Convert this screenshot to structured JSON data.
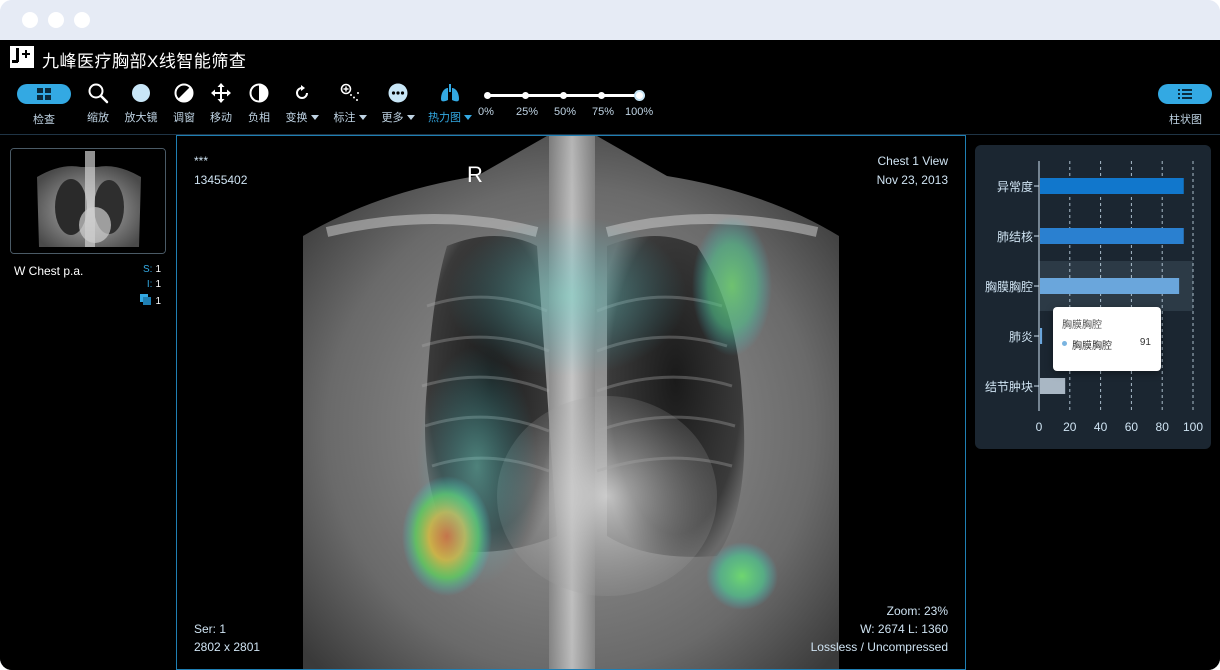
{
  "app": {
    "title": "九峰医疗胸部X线智能筛查"
  },
  "toolbar": {
    "items": [
      {
        "label": "检查",
        "icon": "grid-icon"
      },
      {
        "label": "缩放",
        "icon": "magnifier-icon"
      },
      {
        "label": "放大镜",
        "icon": "circle-icon"
      },
      {
        "label": "调窗",
        "icon": "window-level-icon"
      },
      {
        "label": "移动",
        "icon": "move-arrows-icon"
      },
      {
        "label": "负相",
        "icon": "half-circle-icon"
      },
      {
        "label": "变换",
        "icon": "rotate-icon"
      },
      {
        "label": "标注",
        "icon": "annotate-icon"
      },
      {
        "label": "更多",
        "icon": "more-icon"
      },
      {
        "label": "热力图",
        "icon": "lungs-icon"
      }
    ],
    "opacity_ticks": [
      "0%",
      "25%",
      "50%",
      "75%",
      "100%"
    ],
    "opacity_value_percent": 100,
    "bar_chart_button": {
      "label": "柱状图",
      "icon": "list-icon"
    }
  },
  "left_panel": {
    "series_name": "W Chest p.a.",
    "meta": [
      {
        "key": "S:",
        "value": "1"
      },
      {
        "key": "I:",
        "value": "1"
      },
      {
        "key": "stack-icon",
        "value": "1"
      }
    ]
  },
  "viewer": {
    "top_left": [
      "***",
      "13455402"
    ],
    "top_right": [
      "Chest 1 View",
      "Nov 23, 2013"
    ],
    "bottom_left": [
      "Ser: 1",
      "2802 x 2801"
    ],
    "bottom_right": [
      "Zoom: 23%",
      "W: 2674 L: 1360",
      "Lossless / Uncompressed"
    ],
    "orientation_marker": "R"
  },
  "chart_data": {
    "type": "bar",
    "orientation": "horizontal",
    "categories": [
      "异常度",
      "肺结核",
      "胸膜胸腔",
      "肺炎",
      "结节肿块"
    ],
    "values": [
      94,
      94,
      91,
      2,
      17
    ],
    "xlim": [
      0,
      100
    ],
    "xticks": [
      "0",
      "20",
      "40",
      "60",
      "80",
      "100"
    ],
    "grid": "vertical-dashed",
    "colors": [
      "#1177cc",
      "#2a80d0",
      "#6aa6dc",
      "#6aa6dc",
      "#a9b7c4"
    ],
    "highlighted": "胸膜胸腔",
    "tooltip": {
      "title": "胸膜胸腔",
      "series": "胸膜胸腔",
      "value": "91"
    }
  }
}
